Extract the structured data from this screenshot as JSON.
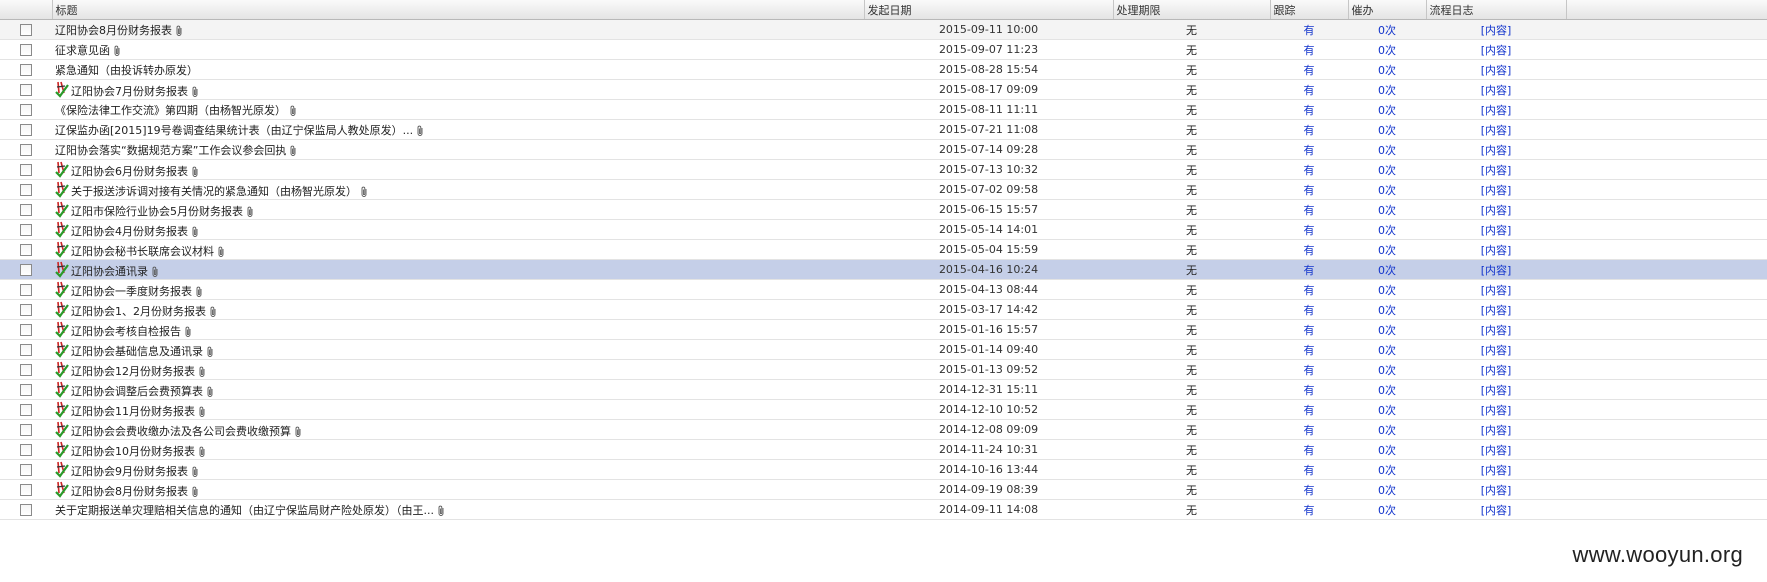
{
  "header": {
    "title": "标题",
    "date": "发起日期",
    "limit": "处理期限",
    "track": "跟踪",
    "urge": "催办",
    "log": "流程日志"
  },
  "rows": [
    {
      "title": "辽阳协会8月份财务报表",
      "date": "2015-09-11 10:00",
      "limit": "无",
      "track": "有",
      "urge": "0次",
      "log": "[内容]",
      "icon": false,
      "clip": true
    },
    {
      "title": "征求意见函",
      "date": "2015-09-07 11:23",
      "limit": "无",
      "track": "有",
      "urge": "0次",
      "log": "[内容]",
      "icon": false,
      "clip": true
    },
    {
      "title": "紧急通知（由投诉转办原发）",
      "date": "2015-08-28 15:54",
      "limit": "无",
      "track": "有",
      "urge": "0次",
      "log": "[内容]",
      "icon": false,
      "clip": false
    },
    {
      "title": "辽阳协会7月份财务报表",
      "date": "2015-08-17 09:09",
      "limit": "无",
      "track": "有",
      "urge": "0次",
      "log": "[内容]",
      "icon": true,
      "clip": true
    },
    {
      "title": "《保险法律工作交流》第四期（由杨智光原发）",
      "date": "2015-08-11 11:11",
      "limit": "无",
      "track": "有",
      "urge": "0次",
      "log": "[内容]",
      "icon": false,
      "clip": true
    },
    {
      "title": "辽保监办函[2015]19号卷调查结果统计表（由辽宁保监局人教处原发）...",
      "date": "2015-07-21 11:08",
      "limit": "无",
      "track": "有",
      "urge": "0次",
      "log": "[内容]",
      "icon": false,
      "clip": true
    },
    {
      "title": "辽阳协会落实“数据规范方案”工作会议参会回执",
      "date": "2015-07-14 09:28",
      "limit": "无",
      "track": "有",
      "urge": "0次",
      "log": "[内容]",
      "icon": false,
      "clip": true
    },
    {
      "title": "辽阳协会6月份财务报表",
      "date": "2015-07-13 10:32",
      "limit": "无",
      "track": "有",
      "urge": "0次",
      "log": "[内容]",
      "icon": true,
      "clip": true
    },
    {
      "title": "关于报送涉诉调对接有关情况的紧急通知（由杨智光原发）",
      "date": "2015-07-02 09:58",
      "limit": "无",
      "track": "有",
      "urge": "0次",
      "log": "[内容]",
      "icon": true,
      "clip": true
    },
    {
      "title": "辽阳市保险行业协会5月份财务报表",
      "date": "2015-06-15 15:57",
      "limit": "无",
      "track": "有",
      "urge": "0次",
      "log": "[内容]",
      "icon": true,
      "clip": true
    },
    {
      "title": "辽阳协会4月份财务报表",
      "date": "2015-05-14 14:01",
      "limit": "无",
      "track": "有",
      "urge": "0次",
      "log": "[内容]",
      "icon": true,
      "clip": true
    },
    {
      "title": "辽阳协会秘书长联席会议材料",
      "date": "2015-05-04 15:59",
      "limit": "无",
      "track": "有",
      "urge": "0次",
      "log": "[内容]",
      "icon": true,
      "clip": true
    },
    {
      "title": "辽阳协会通讯录",
      "date": "2015-04-16 10:24",
      "limit": "无",
      "track": "有",
      "urge": "0次",
      "log": "[内容]",
      "icon": true,
      "clip": true
    },
    {
      "title": "辽阳协会一季度财务报表",
      "date": "2015-04-13 08:44",
      "limit": "无",
      "track": "有",
      "urge": "0次",
      "log": "[内容]",
      "icon": true,
      "clip": true
    },
    {
      "title": "辽阳协会1、2月份财务报表",
      "date": "2015-03-17 14:42",
      "limit": "无",
      "track": "有",
      "urge": "0次",
      "log": "[内容]",
      "icon": true,
      "clip": true
    },
    {
      "title": "辽阳协会考核自检报告",
      "date": "2015-01-16 15:57",
      "limit": "无",
      "track": "有",
      "urge": "0次",
      "log": "[内容]",
      "icon": true,
      "clip": true
    },
    {
      "title": "辽阳协会基础信息及通讯录",
      "date": "2015-01-14 09:40",
      "limit": "无",
      "track": "有",
      "urge": "0次",
      "log": "[内容]",
      "icon": true,
      "clip": true
    },
    {
      "title": "辽阳协会12月份财务报表",
      "date": "2015-01-13 09:52",
      "limit": "无",
      "track": "有",
      "urge": "0次",
      "log": "[内容]",
      "icon": true,
      "clip": true
    },
    {
      "title": "辽阳协会调整后会费预算表",
      "date": "2014-12-31 15:11",
      "limit": "无",
      "track": "有",
      "urge": "0次",
      "log": "[内容]",
      "icon": true,
      "clip": true
    },
    {
      "title": "辽阳协会11月份财务报表",
      "date": "2014-12-10 10:52",
      "limit": "无",
      "track": "有",
      "urge": "0次",
      "log": "[内容]",
      "icon": true,
      "clip": true
    },
    {
      "title": "辽阳协会会费收缴办法及各公司会费收缴预算",
      "date": "2014-12-08 09:09",
      "limit": "无",
      "track": "有",
      "urge": "0次",
      "log": "[内容]",
      "icon": true,
      "clip": true
    },
    {
      "title": "辽阳协会10月份财务报表",
      "date": "2014-11-24 10:31",
      "limit": "无",
      "track": "有",
      "urge": "0次",
      "log": "[内容]",
      "icon": true,
      "clip": true
    },
    {
      "title": "辽阳协会9月份财务报表",
      "date": "2014-10-16 13:44",
      "limit": "无",
      "track": "有",
      "urge": "0次",
      "log": "[内容]",
      "icon": true,
      "clip": true
    },
    {
      "title": "辽阳协会8月份财务报表",
      "date": "2014-09-19 08:39",
      "limit": "无",
      "track": "有",
      "urge": "0次",
      "log": "[内容]",
      "icon": true,
      "clip": true
    },
    {
      "title": "关于定期报送单灾理赔相关信息的通知（由辽宁保监局财产险处原发）（由王...",
      "date": "2014-09-11 14:08",
      "limit": "无",
      "track": "有",
      "urge": "0次",
      "log": "[内容]",
      "icon": false,
      "clip": true
    }
  ],
  "highlighted_row_index": 12,
  "watermark": "www.wooyun.org",
  "colors": {
    "link": "#1133cc",
    "highlight_row": "#c5cfe8",
    "header_bg": "#e4e4e4"
  }
}
